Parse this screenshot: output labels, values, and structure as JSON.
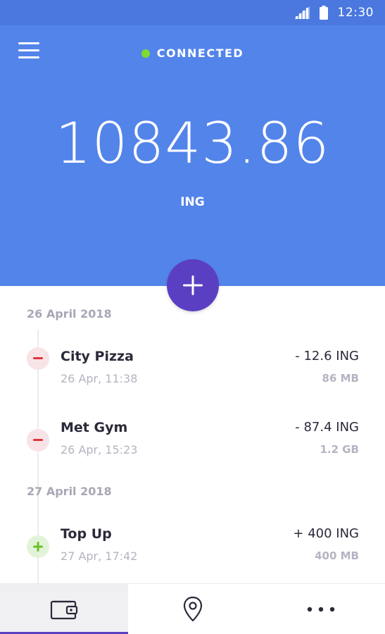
{
  "status_bar": {
    "time": "12:30",
    "icons": [
      "signal-icon",
      "battery-icon"
    ]
  },
  "header": {
    "menu_icon": "menu-icon",
    "connection_status": "CONNECTED",
    "balance": "10843.86",
    "currency": "ING"
  },
  "colors": {
    "header_bg": "#5384ea",
    "status_bg": "#4a78df",
    "accent": "#5b3fc2",
    "connected": "#7fdc2e",
    "minus": "#e0343f",
    "plus": "#69c02a"
  },
  "add_button": {
    "icon": "plus-icon"
  },
  "groups": [
    {
      "date": "26 April 2018",
      "transactions": [
        {
          "type": "minus",
          "name": "City Pizza",
          "datetime": "26 Apr, 11:38",
          "amount": "- 12.6 ING",
          "data": "86 MB"
        },
        {
          "type": "minus",
          "name": "Met Gym",
          "datetime": "26 Apr, 15:23",
          "amount": "- 87.4 ING",
          "data": "1.2 GB"
        }
      ]
    },
    {
      "date": "27 April 2018",
      "transactions": [
        {
          "type": "plus",
          "name": "Top Up",
          "datetime": "27 Apr, 17:42",
          "amount": "+ 400 ING",
          "data": "400 MB"
        }
      ]
    }
  ],
  "bottom_nav": [
    {
      "icon": "wallet-icon",
      "active": true
    },
    {
      "icon": "location-pin-icon",
      "active": false
    },
    {
      "icon": "more-icon",
      "active": false
    }
  ]
}
